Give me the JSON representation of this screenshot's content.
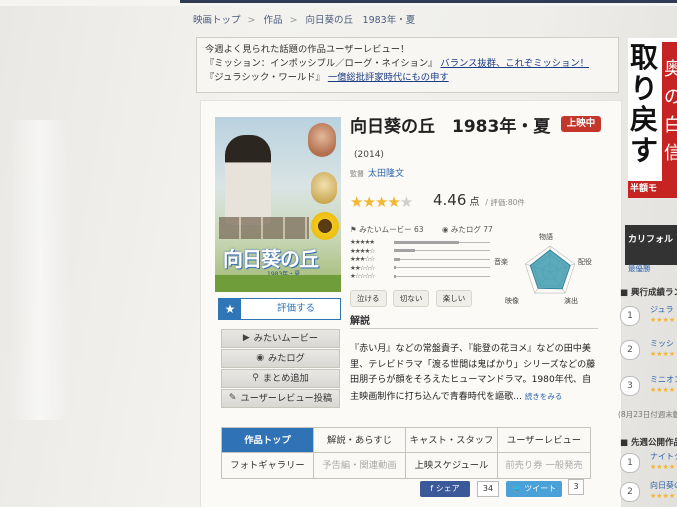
{
  "breadcrumb": [
    "映画トップ",
    "作品",
    "向日葵の丘　1983年・夏"
  ],
  "notice": {
    "line1": "今週よく見られた話題の作品ユーザーレビュー！",
    "line2_title": "『ミッション：インポッシブル／ローグ・ネイション』",
    "line2_link": "バランス抜群、これぞミッション！",
    "line3_title": "『ジュラシック・ワールド』",
    "line3_link": "一億総批評家時代にもの申す"
  },
  "poster": {
    "logo": "向日葵の丘",
    "sub": "1983年・夏"
  },
  "rate_button": {
    "icon": "★",
    "label": "評価する"
  },
  "actions": [
    {
      "icon": "▶",
      "label": "みたいムービー"
    },
    {
      "icon": "◉",
      "label": "みたログ"
    },
    {
      "icon": "⚲",
      "label": "まとめ追加"
    },
    {
      "icon": "✎",
      "label": "ユーザーレビュー投稿"
    }
  ],
  "movie": {
    "title": "向日葵の丘　1983年・夏",
    "year": "(2014)",
    "status": "上映中",
    "director_label": "監督",
    "director": "太田隆文",
    "rating": 4.46,
    "rating_text": "4.46",
    "rating_unit": "点",
    "rating_count": "/ 評価:80件",
    "want_count": "みたいムービー 63",
    "seen_count": "みたログ 77"
  },
  "distribution": [
    {
      "stars": "★★★★★",
      "value": 0.68
    },
    {
      "stars": "★★★★☆",
      "value": 0.22
    },
    {
      "stars": "★★★☆☆",
      "value": 0.06
    },
    {
      "stars": "★★☆☆☆",
      "value": 0.02
    },
    {
      "stars": "★☆☆☆☆",
      "value": 0.02
    }
  ],
  "tags": [
    "泣ける",
    "切ない",
    "楽しい"
  ],
  "radar": {
    "labels": [
      "物語",
      "配役",
      "演出",
      "映像",
      "音楽"
    ],
    "values": [
      0.85,
      0.82,
      0.8,
      0.78,
      0.8
    ],
    "fill": "#3d9bb0"
  },
  "synopsis": {
    "heading": "解説",
    "text": "『赤い月』などの常盤貴子、『能登の花ヨメ』などの田中美里、テレビドラマ「渡る世間は鬼ばかり」シリーズなどの藤田朋子らが顔をそろえたヒューマンドラマ。1980年代、自主映画制作に打ち込んで青春時代を謳歌...",
    "more": "続きをみる"
  },
  "tabs": [
    {
      "label": "作品トップ"
    },
    {
      "label": "解説・あらすじ"
    },
    {
      "label": "キャスト・スタッフ"
    },
    {
      "label": "ユーザーレビュー"
    },
    {
      "label": "フォトギャラリー"
    },
    {
      "label": "予告編・関連動画"
    },
    {
      "label": "上映スケジュール"
    },
    {
      "label": "前売り券 一般発売"
    }
  ],
  "social": {
    "fb_label": "シェア",
    "fb_count": "34",
    "tw_label": "ツイート",
    "tw_count": "3"
  },
  "side": {
    "ad_big": "取り戻す",
    "ad_red": "奥の白信",
    "ad_band": "半額モ",
    "ad2": "カリフォル",
    "ad2_link": "最優勝",
    "ranking_heading": "興行成績ラン",
    "ranks": [
      {
        "num": "1",
        "title": "ジュラ",
        "stars": "★★★★"
      },
      {
        "num": "2",
        "title": "ミッシ イショ",
        "stars": "★★★★"
      },
      {
        "num": "3",
        "title": "ミニオン",
        "stars": "★★★★"
      }
    ],
    "updated": "(8月23日付週末動",
    "preview_heading": "先週公開作品の",
    "previews": [
      {
        "num": "1",
        "title": "ナイトクロ",
        "stars": "★★★★"
      },
      {
        "num": "2",
        "title": "向日葵の丘",
        "stars": "★★★★"
      }
    ]
  },
  "colors": {
    "accent": "#2f72b6",
    "status": "#c4352c",
    "star": "#f2b632"
  }
}
